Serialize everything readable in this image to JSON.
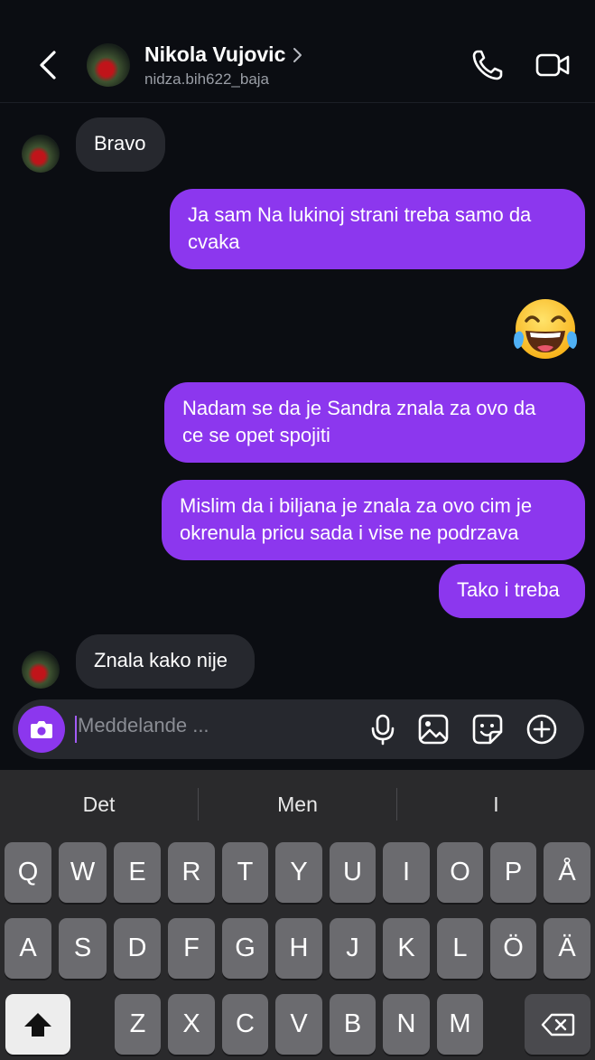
{
  "header": {
    "name": "Nikola Vujovic",
    "username": "nidza.bih622_baja"
  },
  "messages": [
    {
      "side": "in",
      "text": "Bravo"
    },
    {
      "side": "out",
      "lines": [
        "Ja sam Na lukinoj strani treba samo da",
        "cvaka"
      ]
    },
    {
      "side": "out",
      "emoji": "face-with-tears-of-joy"
    },
    {
      "side": "out",
      "lines": [
        "Nadam se da je Sandra znala za ovo da",
        "ce se opet spojiti"
      ]
    },
    {
      "side": "out",
      "lines": [
        "Mislim da i biljana je znala za ovo cim je",
        "okrenula pricu sada i vise ne podrzava"
      ]
    },
    {
      "side": "out",
      "text": "Tako i treba"
    },
    {
      "side": "in",
      "text": "Znala kako nije"
    }
  ],
  "composer": {
    "placeholder": "Meddelande ...",
    "icons": [
      "camera-icon",
      "microphone-icon",
      "gallery-icon",
      "sticker-icon",
      "plus-icon"
    ]
  },
  "keyboard": {
    "suggestions": [
      "Det",
      "Men",
      "I"
    ],
    "row1": [
      "Q",
      "W",
      "E",
      "R",
      "T",
      "Y",
      "U",
      "I",
      "O",
      "P",
      "Å"
    ],
    "row2": [
      "A",
      "S",
      "D",
      "F",
      "G",
      "H",
      "J",
      "K",
      "L",
      "Ö",
      "Ä"
    ],
    "row3": [
      "Z",
      "X",
      "C",
      "V",
      "B",
      "N",
      "M"
    ]
  },
  "colors": {
    "background": "#0b0d12",
    "outgoing_bubble": "#8c37ee",
    "incoming_bubble": "#26282e",
    "keyboard": "#2a2a2c",
    "key": "#6b6b6f"
  }
}
